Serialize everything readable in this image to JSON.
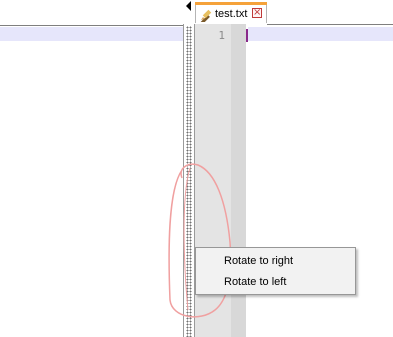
{
  "tab": {
    "label": "test.txt",
    "icon": "pencil-icon",
    "close_icon": "close-icon",
    "accent_color": "#f5a23a"
  },
  "editor": {
    "line_numbers": [
      "1"
    ]
  },
  "context_menu": {
    "items": [
      {
        "label": "Rotate to right"
      },
      {
        "label": "Rotate to left"
      }
    ]
  },
  "annotation": {
    "shape": "hand-drawn-circle",
    "color": "#f0a0a0"
  }
}
